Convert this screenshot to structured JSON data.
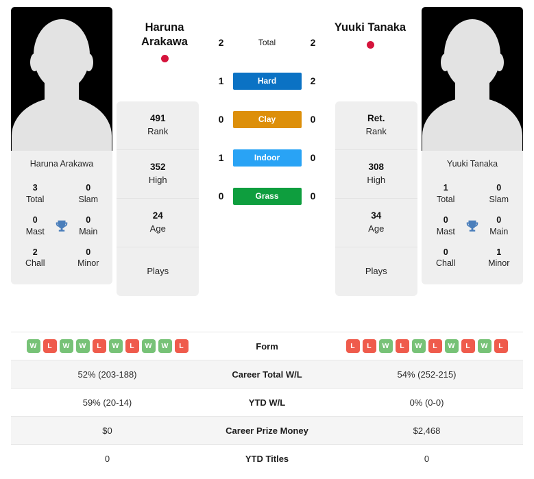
{
  "players": {
    "left": {
      "name": "Haruna Arakawa",
      "name_line1": "Haruna",
      "name_line2": "Arakawa",
      "flag_color": "#d5143c",
      "avatar_caption": "Haruna Arakawa",
      "titles": [
        {
          "value": "3",
          "label": "Total"
        },
        {
          "value": "0",
          "label": "Slam"
        },
        {
          "value": "0",
          "label": "Mast"
        },
        {
          "value": "0",
          "label": "Main"
        },
        {
          "value": "2",
          "label": "Chall"
        },
        {
          "value": "0",
          "label": "Minor"
        }
      ],
      "rank_cells": [
        {
          "value": "491",
          "label": "Rank"
        },
        {
          "value": "352",
          "label": "High"
        },
        {
          "value": "24",
          "label": "Age"
        },
        {
          "value": "",
          "label": "Plays"
        }
      ],
      "form": [
        "W",
        "L",
        "W",
        "W",
        "L",
        "W",
        "L",
        "W",
        "W",
        "L"
      ],
      "career_wl": "52% (203-188)",
      "ytd_wl": "59% (20-14)",
      "career_prize": "$0",
      "ytd_titles": "0"
    },
    "right": {
      "name": "Yuuki Tanaka",
      "name_line1": "Yuuki Tanaka",
      "name_line2": "",
      "flag_color": "#d5143c",
      "avatar_caption": "Yuuki Tanaka",
      "titles": [
        {
          "value": "1",
          "label": "Total"
        },
        {
          "value": "0",
          "label": "Slam"
        },
        {
          "value": "0",
          "label": "Mast"
        },
        {
          "value": "0",
          "label": "Main"
        },
        {
          "value": "0",
          "label": "Chall"
        },
        {
          "value": "1",
          "label": "Minor"
        }
      ],
      "rank_cells": [
        {
          "value": "Ret.",
          "label": "Rank"
        },
        {
          "value": "308",
          "label": "High"
        },
        {
          "value": "34",
          "label": "Age"
        },
        {
          "value": "",
          "label": "Plays"
        }
      ],
      "form": [
        "L",
        "L",
        "W",
        "L",
        "W",
        "L",
        "W",
        "L",
        "W",
        "L"
      ],
      "career_wl": "54% (252-215)",
      "ytd_wl": "0% (0-0)",
      "career_prize": "$2,468",
      "ytd_titles": "0"
    }
  },
  "head_to_head": {
    "total": {
      "label": "Total",
      "left": "2",
      "right": "2"
    },
    "surfaces": [
      {
        "label": "Hard",
        "left": "1",
        "right": "2",
        "color": "#0b72c4"
      },
      {
        "label": "Clay",
        "left": "0",
        "right": "0",
        "color": "#dd8f0a"
      },
      {
        "label": "Indoor",
        "left": "1",
        "right": "0",
        "color": "#29a3f5"
      },
      {
        "label": "Grass",
        "left": "0",
        "right": "0",
        "color": "#0e9e3e"
      }
    ]
  },
  "comparison_rows": [
    {
      "label": "Form",
      "type": "form"
    },
    {
      "label": "Career Total W/L",
      "type": "text",
      "left": "52% (203-188)",
      "right": "54% (252-215)"
    },
    {
      "label": "YTD W/L",
      "type": "text",
      "left": "59% (20-14)",
      "right": "0% (0-0)"
    },
    {
      "label": "Career Prize Money",
      "type": "text",
      "left": "$0",
      "right": "$2,468"
    },
    {
      "label": "YTD Titles",
      "type": "text",
      "left": "0",
      "right": "0"
    }
  ],
  "icons": {
    "trophy": "trophy-icon",
    "flag_dot": "flag-dot-japan-icon",
    "avatar": "player-avatar-placeholder"
  }
}
